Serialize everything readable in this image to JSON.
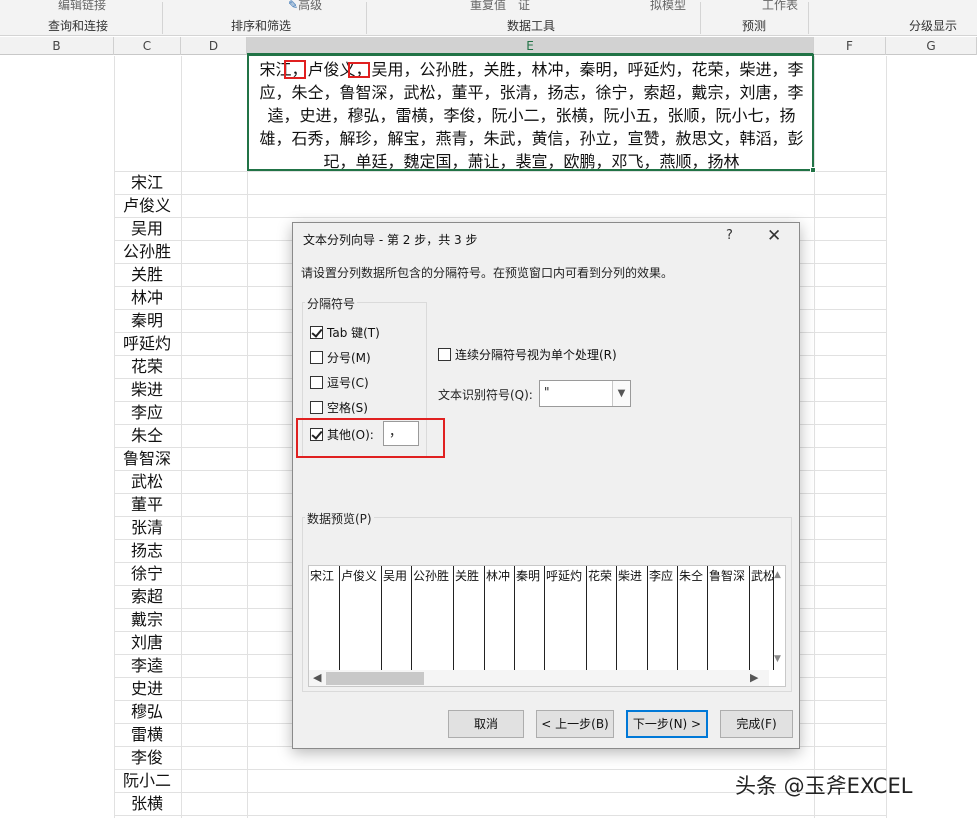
{
  "ribbon": {
    "top_items": [
      "编辑链接",
      "高级",
      "重复值",
      "证",
      "拟模型",
      "工作表"
    ],
    "groups": [
      "查询和连接",
      "排序和筛选",
      "数据工具",
      "预测",
      "分级显示"
    ]
  },
  "columns": [
    "B",
    "C",
    "D",
    "E",
    "F",
    "G"
  ],
  "cell_e1": "宋江，卢俊义，吴用，公孙胜，关胜，林冲，秦明，呼延灼，花荣，柴进，李应，朱仝，鲁智深，武松，董平，张清，扬志，徐宁，索超，戴宗，刘唐，李逵，史进，穆弘，雷横，李俊，阮小二，张横，阮小五，张顺，阮小七，扬雄，石秀，解珍，解宝，燕青，朱武，黄信，孙立，宣赞，赦思文，韩滔，彭玘，单廷，魏定国，萧让，裴宣，欧鹏，邓飞，燕顺，扬林",
  "column_c": [
    "宋江",
    "卢俊义",
    "吴用",
    "公孙胜",
    "关胜",
    "林冲",
    "秦明",
    "呼延灼",
    "花荣",
    "柴进",
    "李应",
    "朱仝",
    "鲁智深",
    "武松",
    "董平",
    "张清",
    "扬志",
    "徐宁",
    "索超",
    "戴宗",
    "刘唐",
    "李逵",
    "史进",
    "穆弘",
    "雷横",
    "李俊",
    "阮小二",
    "张横"
  ],
  "dialog": {
    "title": "文本分列向导 - 第 2 步，共 3 步",
    "help": "?",
    "close": "✕",
    "description": "请设置分列数据所包含的分隔符号。在预览窗口内可看到分列的效果。",
    "delimiter_group": "分隔符号",
    "options": [
      {
        "label": "Tab 键(T)",
        "checked": true
      },
      {
        "label": "分号(M)",
        "checked": false
      },
      {
        "label": "逗号(C)",
        "checked": false
      },
      {
        "label": "空格(S)",
        "checked": false
      },
      {
        "label": "其他(O):",
        "checked": true
      }
    ],
    "other_value": "，",
    "consecutive": {
      "label": "连续分隔符号视为单个处理(R)",
      "checked": false
    },
    "qualifier_label": "文本识别符号(Q):",
    "qualifier_value": "\"",
    "preview_label": "数据预览(P)",
    "preview_columns": [
      "宋江",
      "卢俊义",
      "吴用",
      "公孙胜",
      "关胜",
      "林冲",
      "秦明",
      "呼延灼",
      "花荣",
      "柴进",
      "李应",
      "朱仝",
      "鲁智深",
      "武松"
    ],
    "buttons": {
      "cancel": "取消",
      "back": "< 上一步(B)",
      "next": "下一步(N) >",
      "finish": "完成(F)"
    }
  },
  "watermark": "头条 @玉斧EXCEL",
  "colors": {
    "selection": "#217346",
    "highlight": "#e02020",
    "default_button": "#0078d7"
  }
}
